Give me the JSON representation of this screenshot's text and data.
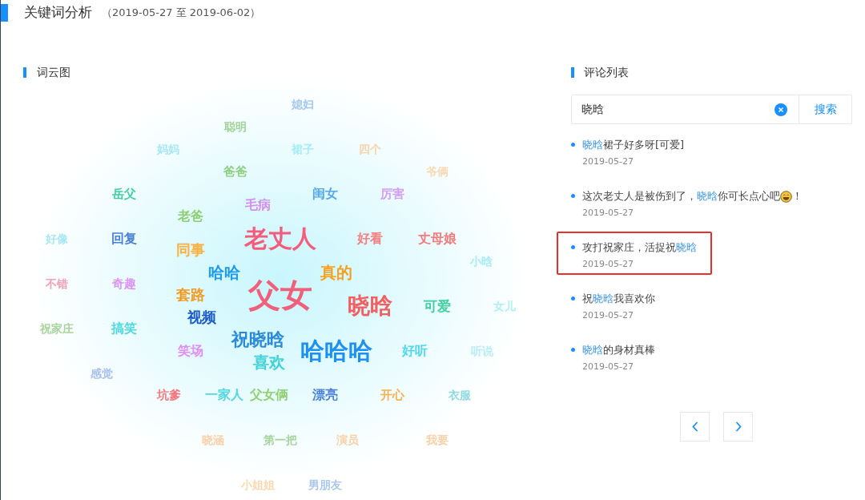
{
  "header": {
    "title": "关键词分析",
    "date_range": "（2019-05-27 至 2019-06-02）"
  },
  "word_cloud": {
    "title": "词云图",
    "words": [
      {
        "text": "媳妇",
        "color": "#a8c8f0"
      },
      {
        "text": "聪明",
        "color": "#9fd398"
      },
      {
        "text": "妈妈",
        "color": "#a8e8f5"
      },
      {
        "text": "裙子",
        "color": "#a8ecf5"
      },
      {
        "text": "四个",
        "color": "#f8d3a8"
      },
      {
        "text": "爸爸",
        "color": "#8cd080"
      },
      {
        "text": "爷俩",
        "color": "#fad8b0"
      },
      {
        "text": "岳父",
        "color": "#3dcf9e"
      },
      {
        "text": "闺女",
        "color": "#55a8f0"
      },
      {
        "text": "厉害",
        "color": "#d59cf5"
      },
      {
        "text": "毛病",
        "color": "#d48cf0"
      },
      {
        "text": "老爸",
        "color": "#8ccf70"
      },
      {
        "text": "好像",
        "color": "#a8e8f5"
      },
      {
        "text": "回复",
        "color": "#4a80d8"
      },
      {
        "text": "老丈人",
        "color": "#f45c7c"
      },
      {
        "text": "好看",
        "color": "#f48080"
      },
      {
        "text": "丈母娘",
        "color": "#f27a7a"
      },
      {
        "text": "同事",
        "color": "#fbb040"
      },
      {
        "text": "小晗",
        "color": "#a8ecf5"
      },
      {
        "text": "哈哈",
        "color": "#1e9bf0"
      },
      {
        "text": "真的",
        "color": "#f5a020"
      },
      {
        "text": "不错",
        "color": "#f2a0b2"
      },
      {
        "text": "奇趣",
        "color": "#dc94f5"
      },
      {
        "text": "套路",
        "color": "#f59a20"
      },
      {
        "text": "父女",
        "color": "#f0607a"
      },
      {
        "text": "晓晗",
        "color": "#f06060"
      },
      {
        "text": "可爱",
        "color": "#40d0a0"
      },
      {
        "text": "女儿",
        "color": "#b0f0f0"
      },
      {
        "text": "视频",
        "color": "#1a5ac8"
      },
      {
        "text": "祝家庄",
        "color": "#a6d49c"
      },
      {
        "text": "搞笑",
        "color": "#50d8e0"
      },
      {
        "text": "祝晓晗",
        "color": "#2a8ad8"
      },
      {
        "text": "笑场",
        "color": "#e08cf5"
      },
      {
        "text": "哈哈哈",
        "color": "#1e90f0"
      },
      {
        "text": "好听",
        "color": "#50d8f0"
      },
      {
        "text": "听说",
        "color": "#b8ecf5"
      },
      {
        "text": "喜欢",
        "color": "#40d0d8"
      },
      {
        "text": "感觉",
        "color": "#a8c0f0"
      },
      {
        "text": "坑爹",
        "color": "#f47880"
      },
      {
        "text": "一家人",
        "color": "#50d8e0"
      },
      {
        "text": "父女俩",
        "color": "#90d070"
      },
      {
        "text": "漂亮",
        "color": "#4a80d8"
      },
      {
        "text": "开心",
        "color": "#f8b050"
      },
      {
        "text": "衣服",
        "color": "#8fd8e2"
      },
      {
        "text": "晓涵",
        "color": "#fad0a8"
      },
      {
        "text": "第一把",
        "color": "#a6d49c"
      },
      {
        "text": "演员",
        "color": "#fad0a8"
      },
      {
        "text": "我要",
        "color": "#fad0a8"
      },
      {
        "text": "小姐姐",
        "color": "#fad8b0"
      },
      {
        "text": "男朋友",
        "color": "#a8c8f0"
      }
    ]
  },
  "comments": {
    "title": "评论列表",
    "search": {
      "value": "晓晗",
      "button": "搜索"
    },
    "items": [
      {
        "highlighted": false,
        "parts": [
          {
            "kind": "keyword",
            "text": "晓晗"
          },
          {
            "kind": "text",
            "text": "裙子好多呀[可爱]"
          }
        ],
        "date": "2019-05-27"
      },
      {
        "highlighted": false,
        "parts": [
          {
            "kind": "text",
            "text": "这次老丈人是被伤到了，"
          },
          {
            "kind": "keyword",
            "text": "晓晗"
          },
          {
            "kind": "text",
            "text": "你可长点心吧"
          },
          {
            "kind": "emoji"
          },
          {
            "kind": "text",
            "text": "！"
          }
        ],
        "date": "2019-05-27"
      },
      {
        "highlighted": true,
        "parts": [
          {
            "kind": "text",
            "text": "攻打祝家庄，活捉祝"
          },
          {
            "kind": "keyword",
            "text": "晓晗"
          }
        ],
        "date": "2019-05-27"
      },
      {
        "highlighted": false,
        "parts": [
          {
            "kind": "text",
            "text": "祝"
          },
          {
            "kind": "keyword",
            "text": "晓晗"
          },
          {
            "kind": "text",
            "text": "我喜欢你"
          }
        ],
        "date": "2019-05-27"
      },
      {
        "highlighted": false,
        "parts": [
          {
            "kind": "keyword",
            "text": "晓晗"
          },
          {
            "kind": "text",
            "text": "的身材真棒"
          }
        ],
        "date": "2019-05-27"
      }
    ]
  }
}
